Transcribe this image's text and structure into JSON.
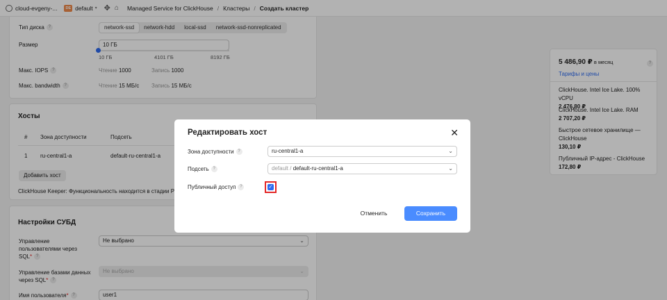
{
  "topbar": {
    "cloud": "cloud-evgeny-...",
    "folder_badge": "DE",
    "folder": "default",
    "breadcrumbs": [
      "Managed Service for ClickHouse",
      "Кластеры",
      "Создать кластер"
    ]
  },
  "storage": {
    "disk_type_label": "Тип диска",
    "disk_types": [
      "network-ssd",
      "network-hdd",
      "local-ssd",
      "network-ssd-nonreplicated"
    ],
    "size_label": "Размер",
    "size_value": "10 ГБ",
    "slider_min": "10 ГБ",
    "slider_mid": "4101 ГБ",
    "slider_max": "8192 ГБ",
    "iops_label": "Макс. IOPS",
    "bandwidth_label": "Макс. bandwidth",
    "read_label": "Чтение",
    "write_label": "Запись",
    "iops_read": "1000",
    "iops_write": "1000",
    "bw_read": "15 МБ/с",
    "bw_write": "15 МБ/с"
  },
  "hosts": {
    "title": "Хосты",
    "col_num": "#",
    "col_zone": "Зона доступности",
    "col_subnet": "Подсеть",
    "row_num": "1",
    "row_zone": "ru-central1-a",
    "row_subnet": "default-ru-central1-a",
    "add_button": "Добавить хост",
    "keeper_label": "ClickHouse Keeper:",
    "keeper_text": "Функциональность находится в стадии Prev"
  },
  "dbms": {
    "title": "Настройки СУБД",
    "sql_users_label": "Управление пользователями через SQL",
    "sql_users_value": "Не выбрано",
    "sql_db_label": "Управление базами данных через SQL",
    "sql_db_value": "Не выбрано",
    "username_label": "Имя пользователя",
    "username_value": "user1"
  },
  "price": {
    "total": "5 486,90 ₽",
    "per": "в месяц",
    "link": "Тарифы и цены",
    "items": [
      {
        "name": "ClickHouse. Intel Ice Lake. 100% vCPU",
        "value": "2 476,80 ₽"
      },
      {
        "name": "ClickHouse. Intel Ice Lake. RAM",
        "value": "2 707,20 ₽"
      },
      {
        "name": "Быстрое сетевое хранилище — ClickHouse",
        "value": "130,10 ₽"
      },
      {
        "name": "Публичный IP-адрес - ClickHouse",
        "value": "172,80 ₽"
      }
    ]
  },
  "modal": {
    "title": "Редактировать хост",
    "zone_label": "Зона доступности",
    "zone_value": "ru-central1-a",
    "subnet_label": "Подсеть",
    "subnet_folder": "default",
    "subnet_sep": "/",
    "subnet_value": "default-ru-central1-a",
    "public_label": "Публичный доступ",
    "public_checked": true,
    "cancel": "Отменить",
    "save": "Сохранить"
  },
  "colors": {
    "accent": "#4a8cff",
    "checkbox": "#2e6bf0",
    "highlight": "#e32626",
    "folder_badge": "#f08a4b"
  }
}
